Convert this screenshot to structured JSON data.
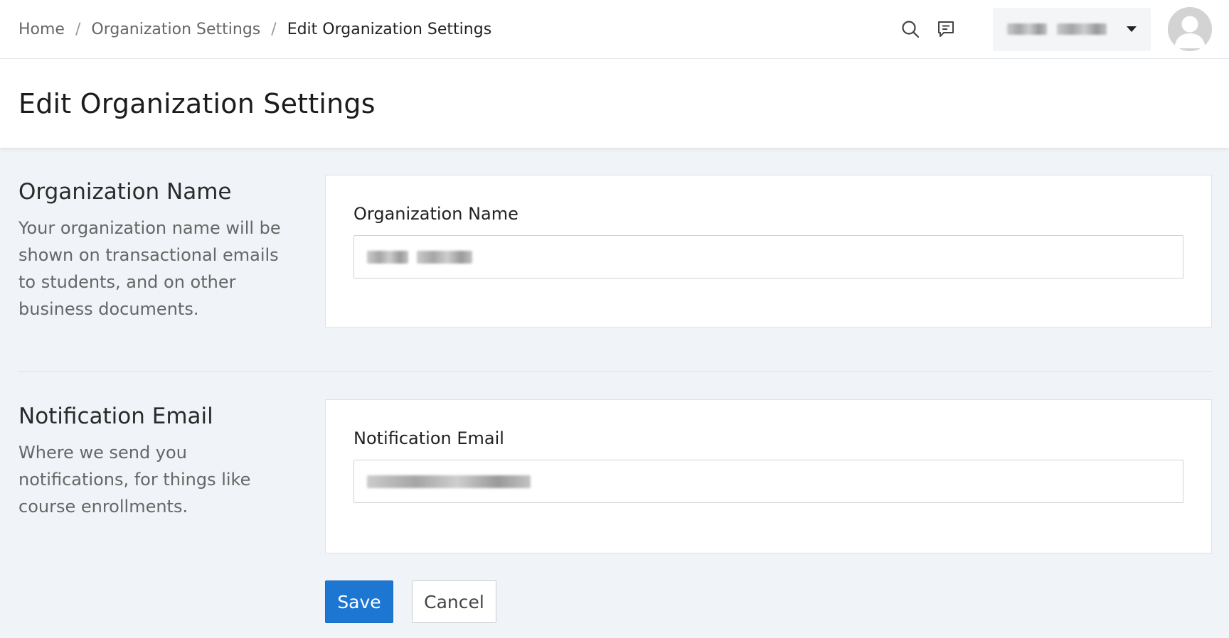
{
  "breadcrumb": {
    "home": "Home",
    "sep1": "/",
    "org_settings": "Organization Settings",
    "sep2": "/",
    "current": "Edit Organization Settings"
  },
  "header": {
    "icons": [
      "search-icon",
      "feedback-icon"
    ],
    "user_menu_icon": "caret-down-icon"
  },
  "page": {
    "title": "Edit Organization Settings"
  },
  "sections": {
    "org_name": {
      "title": "Organization Name",
      "description": "Your organization name will be shown on transactional emails to students, and on other business documents.",
      "field_label": "Organization Name"
    },
    "notification_email": {
      "title": "Notification Email",
      "description": "Where we send you notifications, for things like course enrollments.",
      "field_label": "Notification Email"
    }
  },
  "actions": {
    "save_label": "Save",
    "cancel_label": "Cancel"
  },
  "colors": {
    "primary": "#1d77d2",
    "background": "#f0f3f7"
  }
}
